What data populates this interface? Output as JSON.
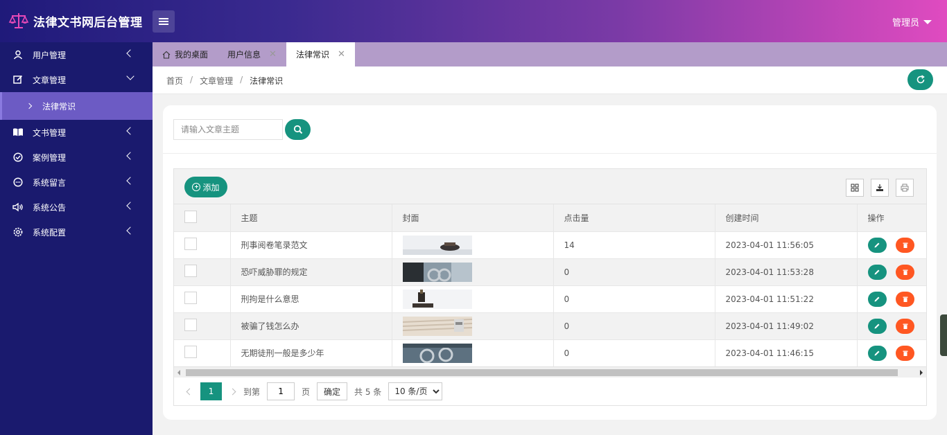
{
  "app": {
    "title": "法律文书网后台管理",
    "user": "管理员"
  },
  "sidebar": {
    "items": [
      {
        "label": "用户管理",
        "icon": "user-icon"
      },
      {
        "label": "文章管理",
        "icon": "edit-icon",
        "expanded": true
      },
      {
        "label": "文书管理",
        "icon": "book-icon"
      },
      {
        "label": "案例管理",
        "icon": "check-circle-icon"
      },
      {
        "label": "系统留言",
        "icon": "message-icon"
      },
      {
        "label": "系统公告",
        "icon": "speaker-icon"
      },
      {
        "label": "系统配置",
        "icon": "gear-icon"
      }
    ],
    "sub_item": "法律常识"
  },
  "tabs": [
    {
      "label": "我的桌面",
      "closable": false
    },
    {
      "label": "用户信息",
      "closable": true
    },
    {
      "label": "法律常识",
      "closable": true,
      "active": true
    }
  ],
  "breadcrumb": {
    "home": "首页",
    "section": "文章管理",
    "current": "法律常识",
    "sep": "/"
  },
  "search": {
    "placeholder": "请输入文章主题"
  },
  "toolbar": {
    "add_label": "添加"
  },
  "table": {
    "headers": {
      "subject": "主题",
      "cover": "封面",
      "clicks": "点击量",
      "created": "创建时间",
      "actions": "操作"
    },
    "rows": [
      {
        "subject": "刑事阅卷笔录范文",
        "clicks": "14",
        "created": "2023-04-01 11:56:05"
      },
      {
        "subject": "恐吓威胁罪的规定",
        "clicks": "0",
        "created": "2023-04-01 11:53:28"
      },
      {
        "subject": "刑拘是什么意思",
        "clicks": "0",
        "created": "2023-04-01 11:51:22"
      },
      {
        "subject": "被骗了钱怎么办",
        "clicks": "0",
        "created": "2023-04-01 11:49:02"
      },
      {
        "subject": "无期徒刑一般是多少年",
        "clicks": "0",
        "created": "2023-04-01 11:46:15"
      }
    ]
  },
  "pager": {
    "current_page": "1",
    "goto_label": "到第",
    "goto_value": "1",
    "page_unit": "页",
    "confirm": "确定",
    "total": "共 5 条",
    "page_size": "10 条/页"
  },
  "colors": {
    "accent": "#16937f",
    "danger": "#ff5722",
    "sidebar": "#1a1a6e",
    "sidebar_active": "#6c5bc4"
  }
}
